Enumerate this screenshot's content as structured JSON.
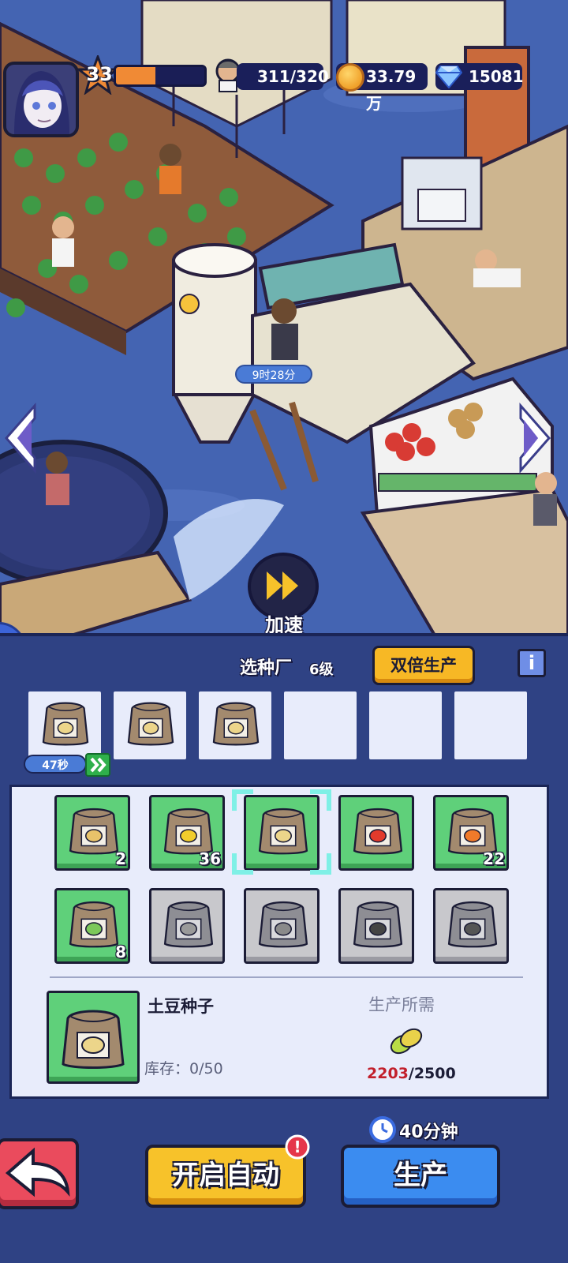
{
  "hud": {
    "player_level": "33",
    "xp_progress": 0.45,
    "population": "311/320",
    "coins": "33.79万",
    "gems": "15081"
  },
  "scene": {
    "timer_text": "9时28分",
    "speed_up_label": "加速"
  },
  "panel": {
    "title": "选种厂",
    "level": "6级",
    "double_button": "双倍生产",
    "info_label": "i",
    "queue": [
      {
        "item": "potato-seed-bag",
        "filled": true
      },
      {
        "item": "potato-seed-bag",
        "filled": true
      },
      {
        "item": "potato-seed-bag",
        "filled": true
      },
      {
        "item": null,
        "filled": false
      },
      {
        "item": null,
        "filled": false
      },
      {
        "item": null,
        "filled": false
      }
    ],
    "queue_timer": "47秒",
    "seeds": [
      {
        "icon": "wheat-seed-bag-icon",
        "count": "2",
        "locked": false,
        "color": "#e9c36a"
      },
      {
        "icon": "corn-seed-bag-icon",
        "count": "36",
        "locked": false,
        "color": "#f1cd2c"
      },
      {
        "icon": "potato-seed-bag-icon",
        "count": "",
        "locked": false,
        "selected": true,
        "color": "#ecd58a"
      },
      {
        "icon": "tomato-seed-bag-icon",
        "count": "",
        "locked": false,
        "color": "#e23a2c"
      },
      {
        "icon": "carrot-seed-bag-icon",
        "count": "22",
        "locked": false,
        "color": "#f07a2a"
      },
      {
        "icon": "cabbage-seed-bag-icon",
        "count": "8",
        "locked": false,
        "color": "#7cc85a"
      },
      {
        "icon": "garlic-seed-bag-icon",
        "count": "",
        "locked": true,
        "color": "#9a9a9a"
      },
      {
        "icon": "pumpkin-seed-bag-icon",
        "count": "",
        "locked": true,
        "color": "#8a8a8a"
      },
      {
        "icon": "pepper-seed-bag-icon",
        "count": "",
        "locked": true,
        "color": "#444444"
      },
      {
        "icon": "eggplant-seed-bag-icon",
        "count": "",
        "locked": true,
        "color": "#555555"
      }
    ],
    "detail": {
      "name": "土豆种子",
      "stock": "库存：0/50",
      "requirement_title": "生产所需",
      "requirement_have": "2203",
      "requirement_need": "/2500"
    },
    "duration": "40分钟",
    "auto_button": "开启自动",
    "alert_mark": "!",
    "produce_button": "生产"
  },
  "colors": {
    "panel_bg": "#2f4284",
    "seed_green": "#5fd07a",
    "accent_yellow": "#f7c22a",
    "accent_blue": "#3b8cf0",
    "accent_red": "#ea4b5d"
  }
}
